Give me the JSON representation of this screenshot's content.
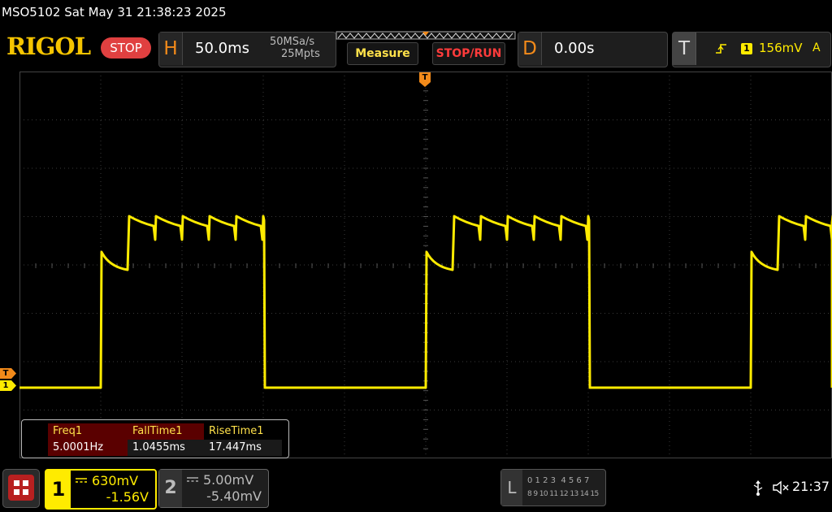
{
  "window": {
    "title": "MSO5102  Sat May 31 21:38:23 2025"
  },
  "brand": {
    "logo": "RIGOL",
    "run_state": "STOP"
  },
  "horizontal": {
    "letter": "H",
    "timebase": "50.0ms",
    "sample_rate": "50MSa/s",
    "memory_depth": "25Mpts"
  },
  "toolbar": {
    "measure_label": "Measure",
    "stoprun_label": "STOP/RUN"
  },
  "delay": {
    "letter": "D",
    "value": "0.00s"
  },
  "trigger": {
    "letter": "T",
    "source": "1",
    "level": "156mV",
    "mode": "A"
  },
  "markers": {
    "trigger_marker": "T",
    "channel1_marker": "1"
  },
  "measurements": {
    "headers": [
      "Freq1",
      "FallTime1",
      "RiseTime1"
    ],
    "values": [
      "5.0001Hz",
      "1.0455ms",
      "17.447ms"
    ]
  },
  "channel1": {
    "number": "1",
    "scale": "630mV",
    "offset": "-1.56V"
  },
  "channel2": {
    "number": "2",
    "scale": "5.00mV",
    "offset": "-5.40mV"
  },
  "logic": {
    "letter": "L",
    "row1": "0 1 2 3  4 5 6 7",
    "row2": "8 9 10 11 12 13 14 15"
  },
  "status": {
    "time": "21:37",
    "usb_icon": "usb-icon",
    "sound_icon": "speaker-muted-icon"
  },
  "colors": {
    "ch1": "#ffeb00",
    "accent": "#f28a1a",
    "stop": "#e04040"
  }
}
